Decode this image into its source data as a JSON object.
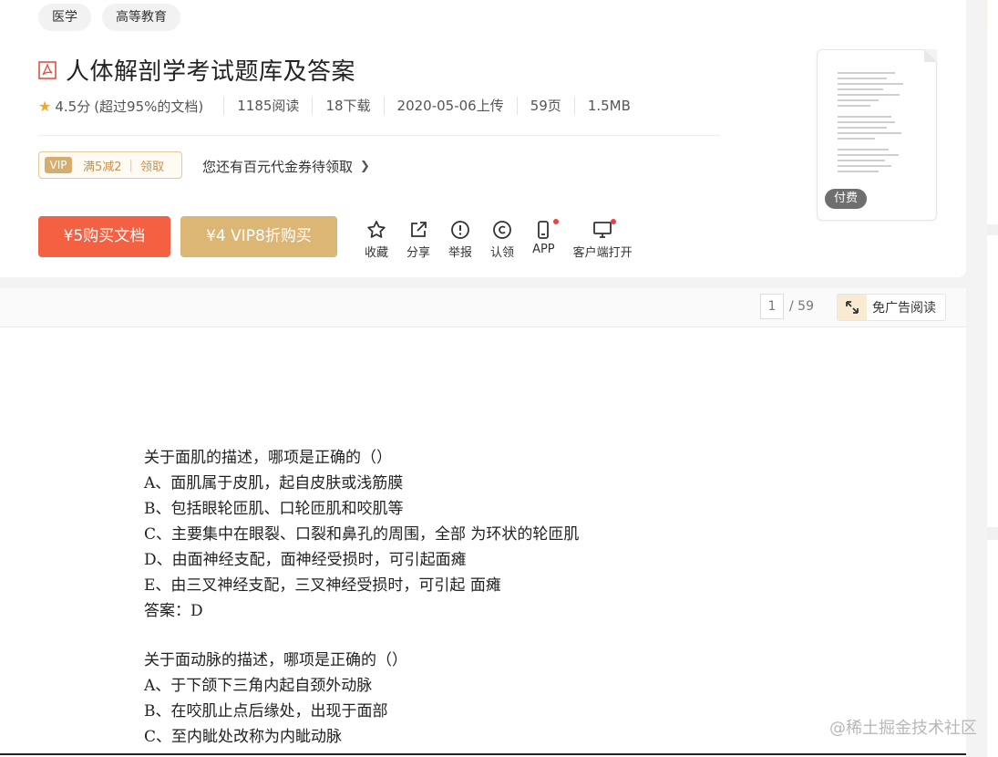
{
  "tags": [
    "医学",
    "高等教育"
  ],
  "document": {
    "title": "人体解剖学考试题库及答案",
    "rating": "4.5分",
    "rating_note": "(超过95%的文档)",
    "reads": "1185阅读",
    "downloads": "18下载",
    "upload_date": "2020-05-06上传",
    "pages": "59页",
    "size": "1.5MB"
  },
  "coupon": {
    "badge": "VIP",
    "offer": "满5减2",
    "claim": "领取",
    "note": "您还有百元代金券待领取"
  },
  "buttons": {
    "buy": "¥5购买文档",
    "vip_buy": "¥4 VIP8折购买"
  },
  "actions": [
    {
      "label": "收藏",
      "icon": "star-outline-icon"
    },
    {
      "label": "分享",
      "icon": "share-icon"
    },
    {
      "label": "举报",
      "icon": "report-icon"
    },
    {
      "label": "认领",
      "icon": "copyright-icon"
    },
    {
      "label": "APP",
      "icon": "phone-icon"
    },
    {
      "label": "客户端打开",
      "icon": "monitor-icon"
    }
  ],
  "thumbnail": {
    "badge": "付费"
  },
  "reader": {
    "current_page": "1",
    "total_pages": "/ 59",
    "adfree_label": "免广告阅读"
  },
  "content": {
    "q1": {
      "question": "关于面肌的描述，哪项是正确的（）",
      "options": [
        "A、面肌属于皮肌，起自皮肤或浅筋膜",
        "B、包括眼轮匝肌、口轮匝肌和咬肌等",
        "C、主要集中在眼裂、口裂和鼻孔的周围，全部 为环状的轮匝肌",
        "D、由面神经支配，面神经受损时，可引起面瘫",
        "E、由三叉神经支配，三叉神经受损时，可引起 面瘫"
      ],
      "answer": "答案：D"
    },
    "q2": {
      "question": "关于面动脉的描述，哪项是正确的（）",
      "options": [
        "A、于下颌下三角内起自颈外动脉",
        "B、在咬肌止点后缘处，出现于面部",
        "C、至内眦处改称为内眦动脉"
      ]
    }
  },
  "watermark": "@稀土掘金技术社区",
  "colors": {
    "buy": "#f36142",
    "vip": "#dbb675",
    "star": "#f5a623"
  }
}
